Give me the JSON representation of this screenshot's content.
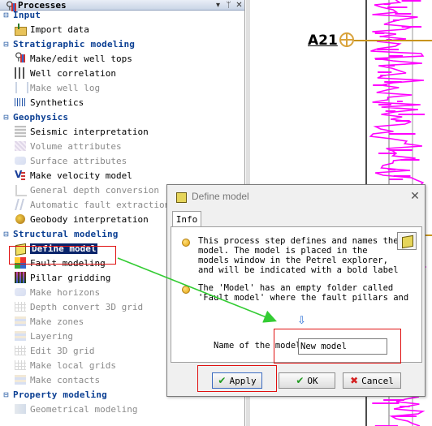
{
  "panel": {
    "title": "Processes",
    "controls": [
      "▾",
      "ᛘ",
      "✕"
    ]
  },
  "tree": [
    {
      "type": "category",
      "label": "Input"
    },
    {
      "type": "item",
      "label": "Import data",
      "icon": "folder-import-icon",
      "enabled": true
    },
    {
      "type": "category",
      "label": "Stratigraphic modeling"
    },
    {
      "type": "item",
      "label": "Make/edit well tops",
      "icon": "well-tops-icon",
      "enabled": true
    },
    {
      "type": "item",
      "label": "Well correlation",
      "icon": "well-correlation-icon",
      "enabled": true
    },
    {
      "type": "item",
      "label": "Make well log",
      "icon": "well-log-icon",
      "enabled": false
    },
    {
      "type": "item",
      "label": "Synthetics",
      "icon": "synthetics-icon",
      "enabled": true
    },
    {
      "type": "category",
      "label": "Geophysics"
    },
    {
      "type": "item",
      "label": "Seismic interpretation",
      "icon": "seismic-interpretation-icon",
      "enabled": true
    },
    {
      "type": "item",
      "label": "Volume attributes",
      "icon": "volume-attributes-icon",
      "enabled": false
    },
    {
      "type": "item",
      "label": "Surface attributes",
      "icon": "surface-attributes-icon",
      "enabled": false
    },
    {
      "type": "item",
      "label": "Make velocity model",
      "icon": "velocity-model-icon",
      "enabled": true
    },
    {
      "type": "item",
      "label": "General depth conversion",
      "icon": "depth-conversion-icon",
      "enabled": false
    },
    {
      "type": "item",
      "label": "Automatic fault extraction",
      "icon": "fault-extraction-icon",
      "enabled": false
    },
    {
      "type": "item",
      "label": "Geobody interpretation",
      "icon": "geobody-icon",
      "enabled": true
    },
    {
      "type": "category",
      "label": "Structural modeling"
    },
    {
      "type": "item",
      "label": "Define model",
      "icon": "define-model-cube-icon",
      "enabled": true,
      "selected": true
    },
    {
      "type": "item",
      "label": "Fault modeling",
      "icon": "fault-modeling-icon",
      "enabled": true
    },
    {
      "type": "item",
      "label": "Pillar gridding",
      "icon": "pillar-gridding-icon",
      "enabled": true
    },
    {
      "type": "item",
      "label": "Make horizons",
      "icon": "make-horizons-icon",
      "enabled": false
    },
    {
      "type": "item",
      "label": "Depth convert 3D grid",
      "icon": "depth-convert-grid-icon",
      "enabled": false
    },
    {
      "type": "item",
      "label": "Make zones",
      "icon": "make-zones-icon",
      "enabled": false
    },
    {
      "type": "item",
      "label": "Layering",
      "icon": "layering-icon",
      "enabled": false
    },
    {
      "type": "item",
      "label": "Edit 3D grid",
      "icon": "edit-grid-icon",
      "enabled": false
    },
    {
      "type": "item",
      "label": "Make local grids",
      "icon": "local-grids-icon",
      "enabled": false
    },
    {
      "type": "item",
      "label": "Make contacts",
      "icon": "make-contacts-icon",
      "enabled": false
    },
    {
      "type": "category",
      "label": "Property modeling"
    },
    {
      "type": "item",
      "label": "Geometrical modeling",
      "icon": "geometrical-modeling-icon",
      "enabled": false
    }
  ],
  "log_view": {
    "well_label": "A21",
    "marker_color": "#d9a33c",
    "log_color": "#ff00ff"
  },
  "dialog": {
    "title": "Define model",
    "close_glyph": "✕",
    "tab_label": "Info",
    "paragraph1": "This process step defines and names the\nmodel. The model is placed in the\nmodels window in the Petrel explorer,\nand will be indicated with a bold label",
    "paragraph2": "The 'Model' has an empty folder called\n'Fault model' where the fault pillars and",
    "down_arrow": "⇩",
    "name_label": "Name of the model",
    "name_value": "New model",
    "apply_label": "Apply",
    "ok_label": "OK",
    "cancel_label": "Cancel",
    "apply_glyph": "✔",
    "ok_glyph": "✔",
    "cancel_glyph": "✖"
  },
  "colors": {
    "category_text": "#0b3f93",
    "selection_bg": "#0a246a",
    "highlight_box": "#e01010",
    "arrow": "#33cc33"
  }
}
